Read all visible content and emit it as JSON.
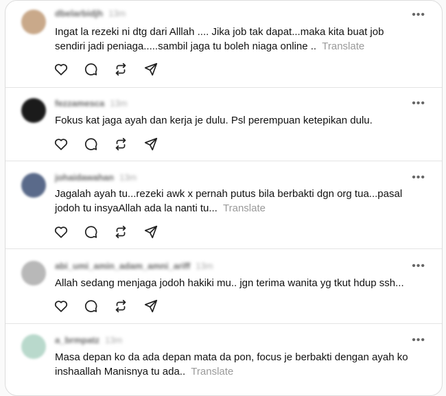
{
  "more_label": "•••",
  "translate_label": "Translate",
  "posts": [
    {
      "username": "dbelarbidjh",
      "time": "13m",
      "text": "Ingat la rezeki ni dtg dari Alllah .... Jika job tak dapat...maka kita buat job sendiri jadi peniaga.....sambil jaga tu boleh niaga online .. ",
      "avatar_color": "#c9a98a"
    },
    {
      "username": "fezzamesca",
      "time": "13m",
      "text": "Fokus kat jaga ayah dan kerja je dulu. Psl perempuan ketepikan dulu.",
      "avatar_color": "#1b1b1b"
    },
    {
      "username": "johaidawahan",
      "time": "13m",
      "text": "Jagalah ayah tu...rezeki awk x pernah putus bila berbakti dgn org tua...pasal jodoh tu insyaAllah ada la nanti tu... ",
      "avatar_color": "#5a6a8a"
    },
    {
      "username": "abi_umi_amin_adam_amni_ariff",
      "time": "13m",
      "text": "Allah sedang menjaga jodoh hakiki mu.. jgn terima wanita yg tkut hdup ssh...",
      "avatar_color": "#b8b8b8"
    },
    {
      "username": "a_brmpatz",
      "time": "13m",
      "text": "Masa depan ko da ada depan mata da pon, focus je berbakti dengan ayah ko inshaallah Manisnya tu ada.. ",
      "avatar_color": "#b9d9cc"
    }
  ]
}
